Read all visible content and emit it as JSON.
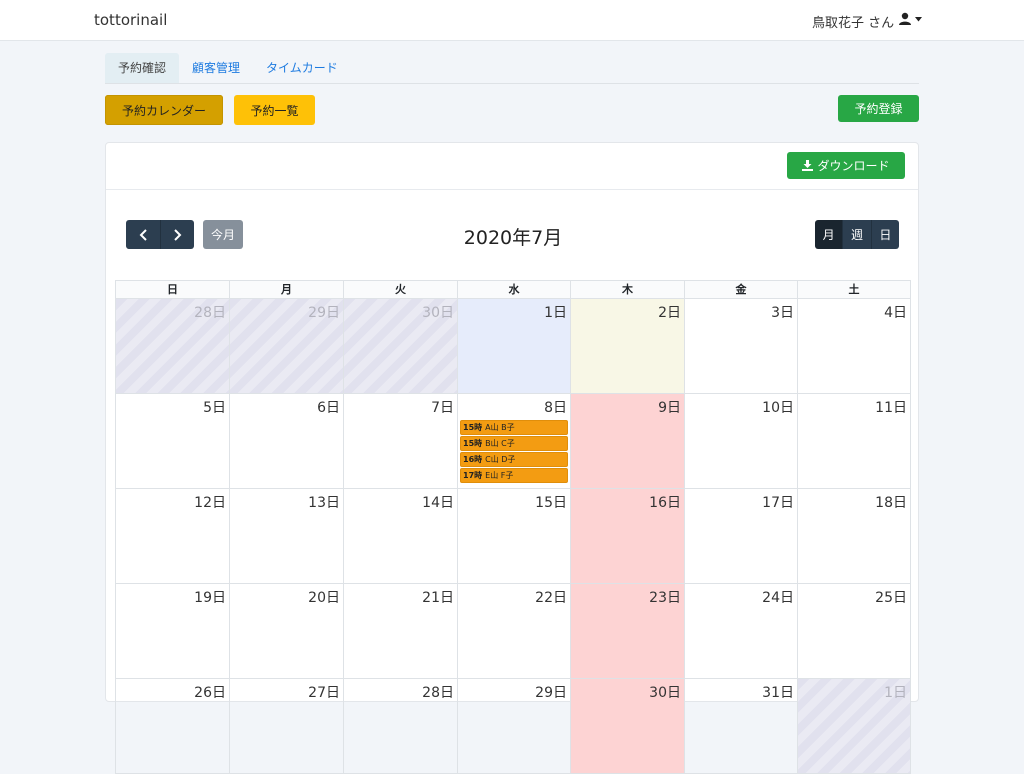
{
  "navbar": {
    "brand": "tottorinail",
    "user": "鳥取花子 さん",
    "user_menu_icon": "user-dropdown-icon"
  },
  "tabs": [
    {
      "label": "予約確認",
      "active": true
    },
    {
      "label": "顧客管理",
      "active": false
    },
    {
      "label": "タイムカード",
      "active": false
    }
  ],
  "toolbar": {
    "calendar_button": "予約カレンダー",
    "list_button": "予約一覧",
    "register_button": "予約登録"
  },
  "card": {
    "download_button": "ダウンロード"
  },
  "calendar": {
    "title": "2020年7月",
    "prev_icon": "chevron-left-icon",
    "next_icon": "chevron-right-icon",
    "today_button": "今月",
    "views": [
      {
        "label": "月",
        "active": true
      },
      {
        "label": "週",
        "active": false
      },
      {
        "label": "日",
        "active": false
      }
    ],
    "weekdays": [
      "日",
      "月",
      "火",
      "水",
      "木",
      "金",
      "土"
    ],
    "weeks": [
      [
        {
          "label": "28日",
          "state": "other"
        },
        {
          "label": "29日",
          "state": "other"
        },
        {
          "label": "30日",
          "state": "other"
        },
        {
          "label": "1日",
          "state": "today"
        },
        {
          "label": "2日",
          "state": "highlight"
        },
        {
          "label": "3日",
          "state": ""
        },
        {
          "label": "4日",
          "state": ""
        }
      ],
      [
        {
          "label": "5日",
          "state": ""
        },
        {
          "label": "6日",
          "state": ""
        },
        {
          "label": "7日",
          "state": ""
        },
        {
          "label": "8日",
          "state": "",
          "events": [
            {
              "time": "15時",
              "name": "A山 B子"
            },
            {
              "time": "15時",
              "name": "B山 C子"
            },
            {
              "time": "16時",
              "name": "C山 D子"
            },
            {
              "time": "17時",
              "name": "E山 F子"
            }
          ]
        },
        {
          "label": "9日",
          "state": "holiday"
        },
        {
          "label": "10日",
          "state": ""
        },
        {
          "label": "11日",
          "state": ""
        }
      ],
      [
        {
          "label": "12日",
          "state": ""
        },
        {
          "label": "13日",
          "state": ""
        },
        {
          "label": "14日",
          "state": ""
        },
        {
          "label": "15日",
          "state": ""
        },
        {
          "label": "16日",
          "state": "holiday"
        },
        {
          "label": "17日",
          "state": ""
        },
        {
          "label": "18日",
          "state": ""
        }
      ],
      [
        {
          "label": "19日",
          "state": ""
        },
        {
          "label": "20日",
          "state": ""
        },
        {
          "label": "21日",
          "state": ""
        },
        {
          "label": "22日",
          "state": ""
        },
        {
          "label": "23日",
          "state": "holiday"
        },
        {
          "label": "24日",
          "state": ""
        },
        {
          "label": "25日",
          "state": ""
        }
      ],
      [
        {
          "label": "26日",
          "state": ""
        },
        {
          "label": "27日",
          "state": ""
        },
        {
          "label": "28日",
          "state": ""
        },
        {
          "label": "29日",
          "state": ""
        },
        {
          "label": "30日",
          "state": "holiday"
        },
        {
          "label": "31日",
          "state": ""
        },
        {
          "label": "1日",
          "state": "other"
        }
      ]
    ]
  },
  "colors": {
    "primary_link": "#1e7be0",
    "calendar_button": "#d4a000",
    "list_button": "#fec107",
    "register_button": "#28a745",
    "nav_dark": "#2c3e50",
    "event": "#f39c12",
    "holiday": "#fdd3d3",
    "today": "#e6ecfb"
  }
}
